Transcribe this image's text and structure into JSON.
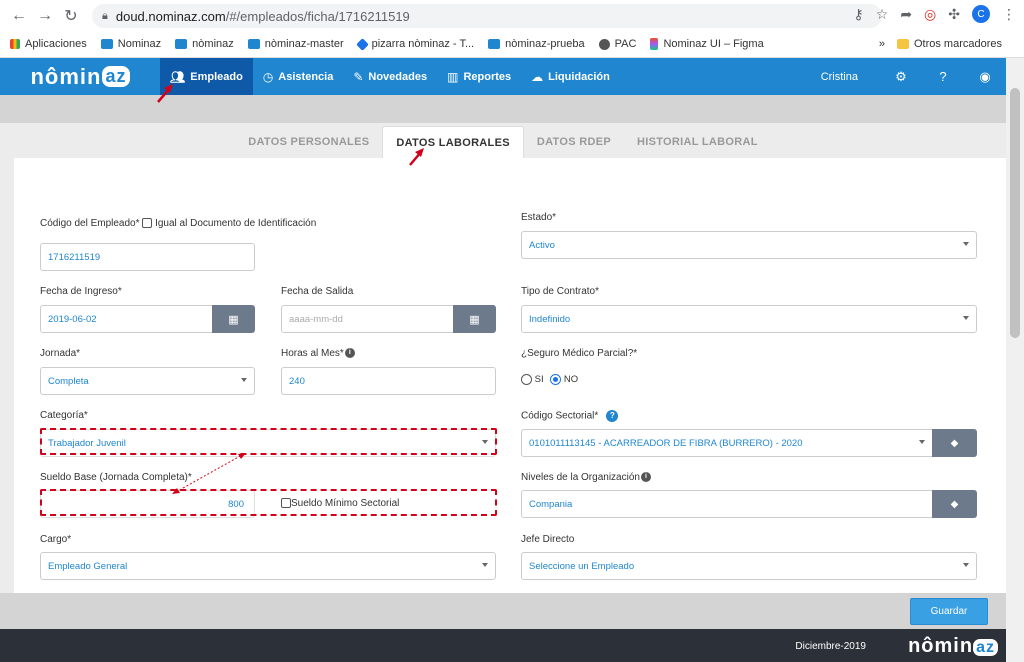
{
  "browser": {
    "url_host": "doud.nominaz.com",
    "url_path": "/#/empleados/ficha/1716211519",
    "profile_initial": "C",
    "bookmarks": [
      "Aplicaciones",
      "Nominaz",
      "nòminaz",
      "nòminaz-master",
      "pizarra nòminaz - T...",
      "nòminaz-prueba",
      "PAC",
      "Nominaz UI – Figma"
    ],
    "more": "»",
    "other_bookmarks": "Otros marcadores"
  },
  "nav": {
    "logo_main": "nômin",
    "logo_az": "az",
    "items": [
      "Empleado",
      "Asistencia",
      "Novedades",
      "Reportes",
      "Liquidación"
    ],
    "user": "Cristina"
  },
  "tabs": [
    "DATOS PERSONALES",
    "DATOS LABORALES",
    "DATOS RDEP",
    "HISTORIAL LABORAL"
  ],
  "form": {
    "codigo_label": "Código del Empleado*",
    "igual_label": "Igual al Documento de Identificación",
    "codigo_value": "1716211519",
    "estado_label": "Estado*",
    "estado_value": "Activo",
    "ingreso_label": "Fecha de Ingreso*",
    "ingreso_value": "2019-06-02",
    "salida_label": "Fecha de Salida",
    "salida_placeholder": "aaaa-mm-dd",
    "contrato_label": "Tipo de Contrato*",
    "contrato_value": "Indefinido",
    "jornada_label": "Jornada*",
    "jornada_value": "Completa",
    "horas_label": "Horas al Mes*",
    "horas_value": "240",
    "seguro_label": "¿Seguro Médico Parcial?*",
    "seguro_si": "SI",
    "seguro_no": "NO",
    "categoria_label": "Categoría*",
    "categoria_value": "Trabajador Juvenil",
    "sectorial_label": "Código Sectorial*",
    "sectorial_value": "0101011113145 - ACARREADOR DE FIBRA (BURRERO) - 2020",
    "sueldo_label": "Sueldo Base (Jornada Completa)*",
    "sueldo_value": "800",
    "sueldo_min_label": "Sueldo Mínimo Sectorial",
    "niveles_label": "Niveles de la Organización",
    "niveles_value": "Compania",
    "cargo_label": "Cargo*",
    "cargo_value": "Empleado General",
    "jefe_label": "Jefe Directo",
    "jefe_value": "Seleccione un Empleado",
    "guardar": "Guardar"
  },
  "footer": {
    "date": "Diciembre-2019",
    "logo_main": "nômin",
    "logo_az": "az"
  },
  "colors": {
    "nav": "#1f86cf",
    "nav_active": "#0f5aa8",
    "annotation": "#d0021b"
  }
}
